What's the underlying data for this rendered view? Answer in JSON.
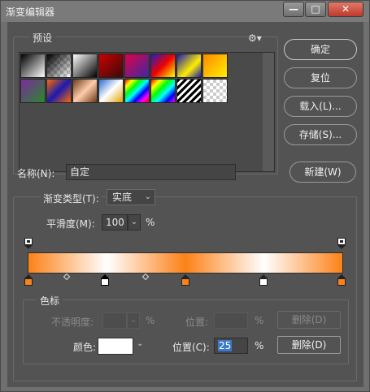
{
  "window": {
    "title": "渐变编辑器",
    "controls": {
      "minimize": "—",
      "maximize": "□",
      "close": "✕"
    }
  },
  "presets": {
    "legend": "预设",
    "menu_icon": "gear-icon"
  },
  "buttons": {
    "ok": "确定",
    "reset": "复位",
    "load": "载入(L)...",
    "save": "存储(S)...",
    "new": "新建(W)"
  },
  "name": {
    "label": "名称(N):",
    "value": "自定"
  },
  "gradient_type": {
    "label": "渐变类型(T):",
    "value": "实底"
  },
  "smoothness": {
    "label": "平滑度(M):",
    "value": "100",
    "unit": "%"
  },
  "stops": {
    "legend": "色标",
    "opacity_label": "不透明度:",
    "opacity_unit": "%",
    "location_label_top": "位置:",
    "location_unit_top": "%",
    "delete_top": "删除(D)",
    "color_label": "颜色:",
    "location_label": "位置(C):",
    "location_value": "25",
    "location_unit": "%",
    "delete_bottom": "删除(D)"
  },
  "colors": {
    "orange": "#fb8218",
    "white": "#ffffff",
    "panel": "#535353"
  }
}
